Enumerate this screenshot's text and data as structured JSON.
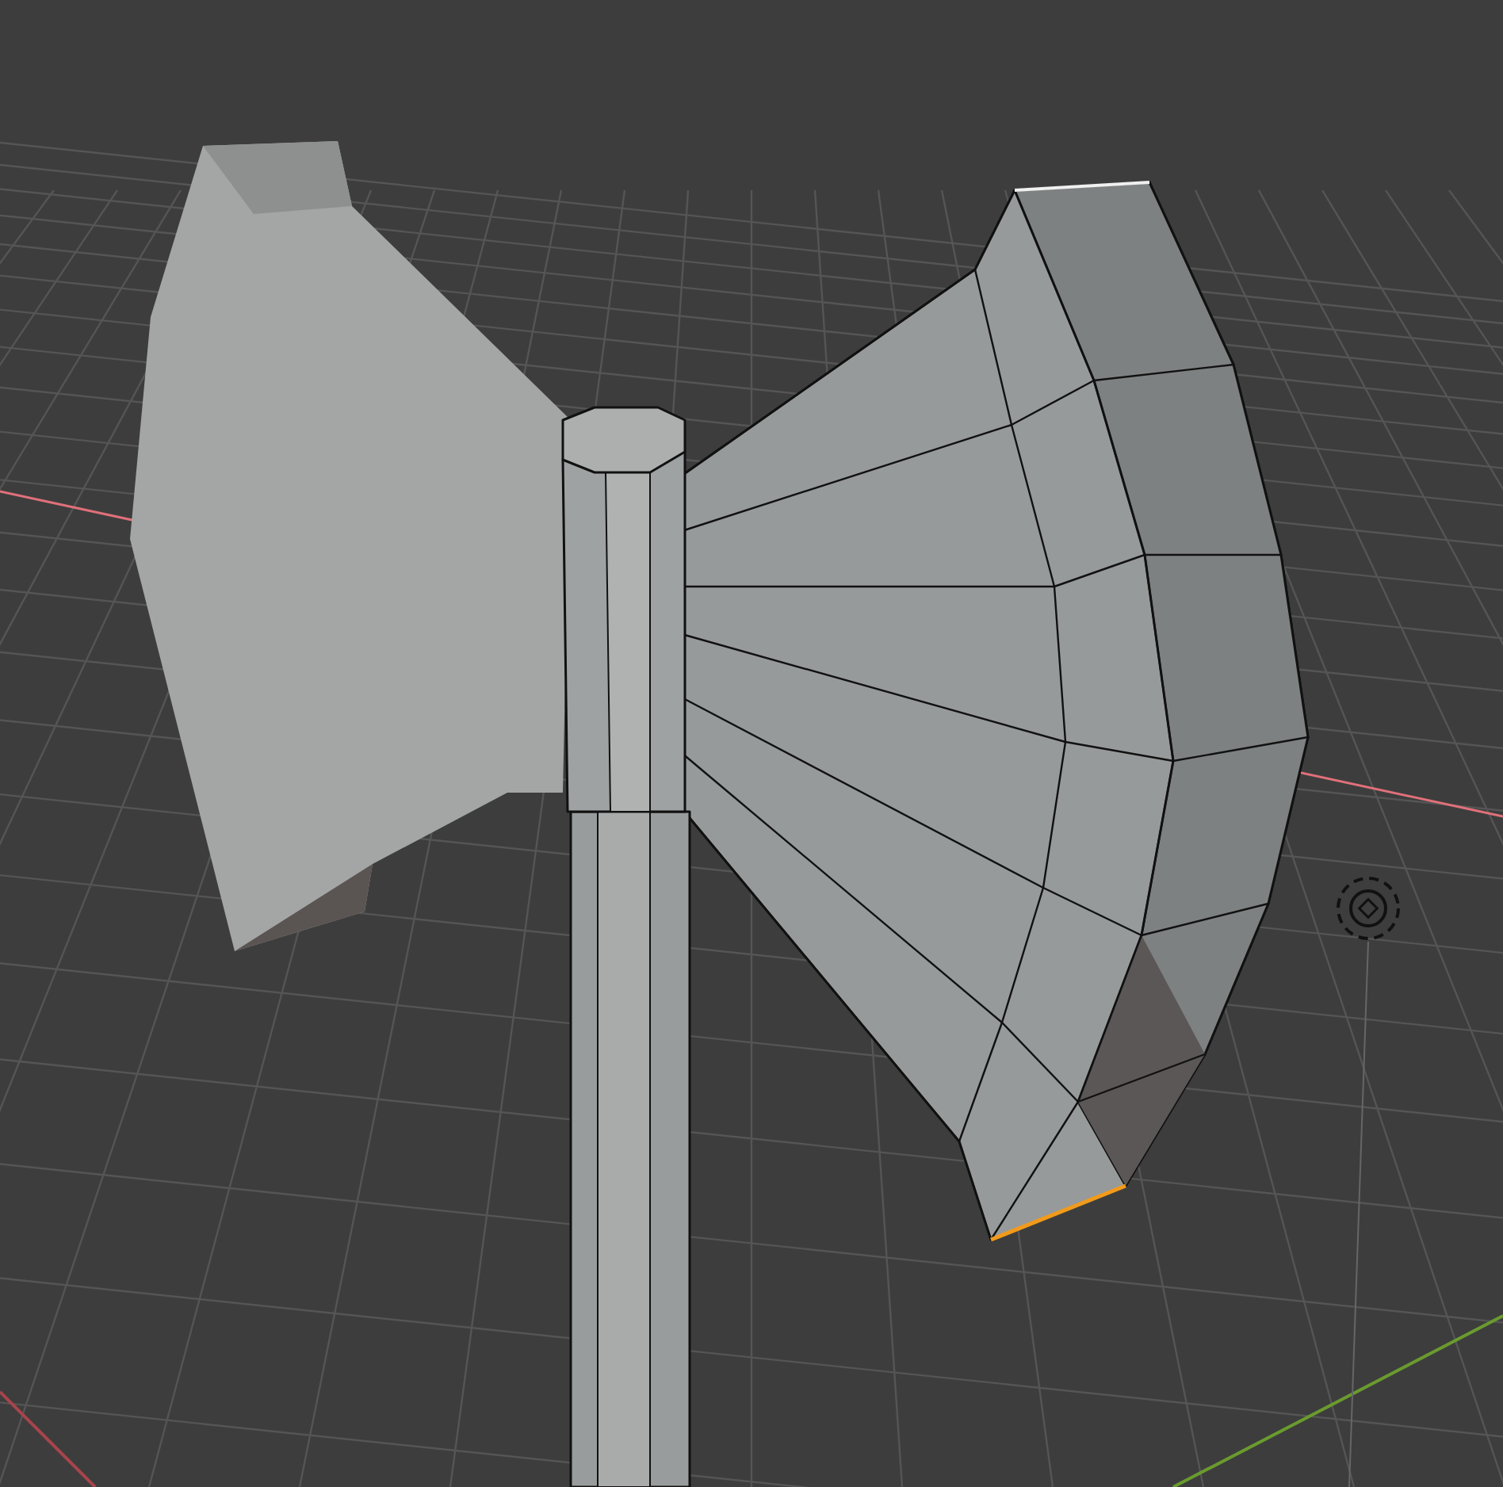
{
  "viewport": {
    "show_grid": true,
    "show_axes": true,
    "edit_mode": true,
    "show_cursor": true
  }
}
